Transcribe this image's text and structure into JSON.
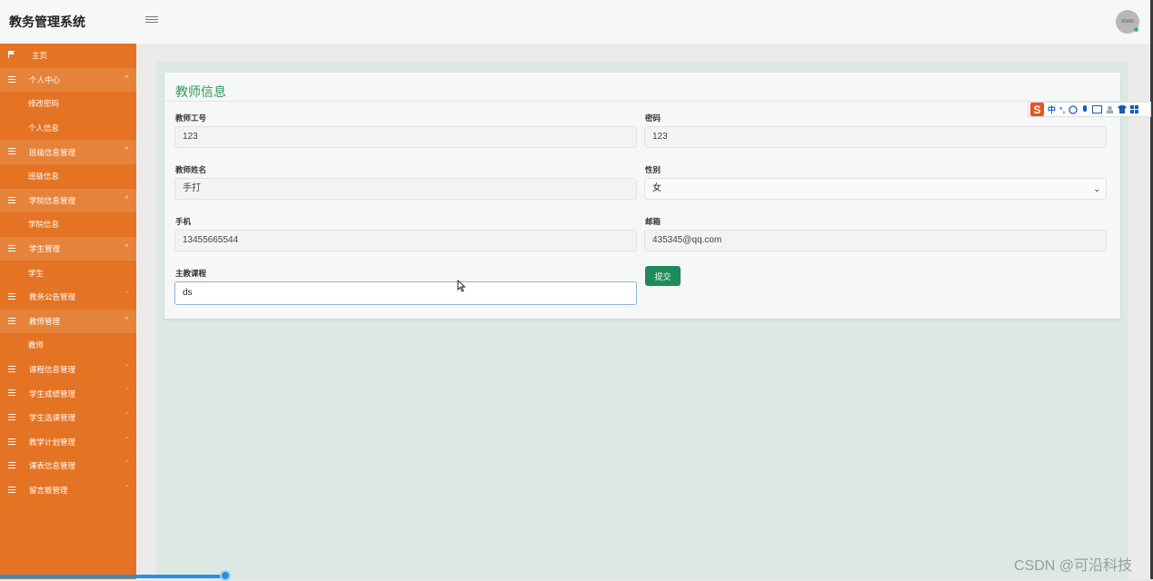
{
  "app": {
    "title": "教务管理系统",
    "avatar_text": "60x60"
  },
  "sidebar": {
    "home": "主页",
    "items": [
      {
        "label": "个人中心",
        "type": "group",
        "caret": "^"
      },
      {
        "label": "修改密码",
        "type": "sub"
      },
      {
        "label": "个人信息",
        "type": "sub"
      },
      {
        "label": "班级信息管理",
        "type": "group",
        "caret": "^"
      },
      {
        "label": "班级信息",
        "type": "sub"
      },
      {
        "label": "学院信息管理",
        "type": "group",
        "caret": "^"
      },
      {
        "label": "学院信息",
        "type": "sub"
      },
      {
        "label": "学生管理",
        "type": "group",
        "caret": "^"
      },
      {
        "label": "学生",
        "type": "sub"
      },
      {
        "label": "教务公告管理",
        "type": "plain",
        "caret": "ˇ"
      },
      {
        "label": "教师管理",
        "type": "group",
        "caret": "^"
      },
      {
        "label": "教师",
        "type": "sub"
      },
      {
        "label": "课程信息管理",
        "type": "plain",
        "caret": "ˇ"
      },
      {
        "label": "学生成绩管理",
        "type": "plain",
        "caret": "ˇ"
      },
      {
        "label": "学生选课管理",
        "type": "plain",
        "caret": "ˇ"
      },
      {
        "label": "教学计划管理",
        "type": "plain",
        "caret": "ˇ"
      },
      {
        "label": "课表信息管理",
        "type": "plain",
        "caret": "ˇ"
      },
      {
        "label": "留言板管理",
        "type": "plain",
        "caret": "ˇ"
      }
    ]
  },
  "form": {
    "title": "教师信息",
    "teacher_id": {
      "label": "教师工号",
      "value": "123"
    },
    "password": {
      "label": "密码",
      "value": "123"
    },
    "teacher_name": {
      "label": "教师姓名",
      "value": "手打"
    },
    "gender": {
      "label": "性别",
      "value": "女"
    },
    "phone": {
      "label": "手机",
      "value": "13455665544"
    },
    "email": {
      "label": "邮箱",
      "value": "435345@qq.com"
    },
    "course": {
      "label": "主教课程",
      "value": "ds"
    },
    "submit_label": "提交"
  },
  "ime_toolbar": {
    "logo": "S",
    "mode": "中",
    "punct": "°,"
  },
  "watermark": "CSDN @可沿科技",
  "colors": {
    "sidebar": "#e57324",
    "accent_green": "#2f9a57",
    "button": "#1f8a5a"
  }
}
